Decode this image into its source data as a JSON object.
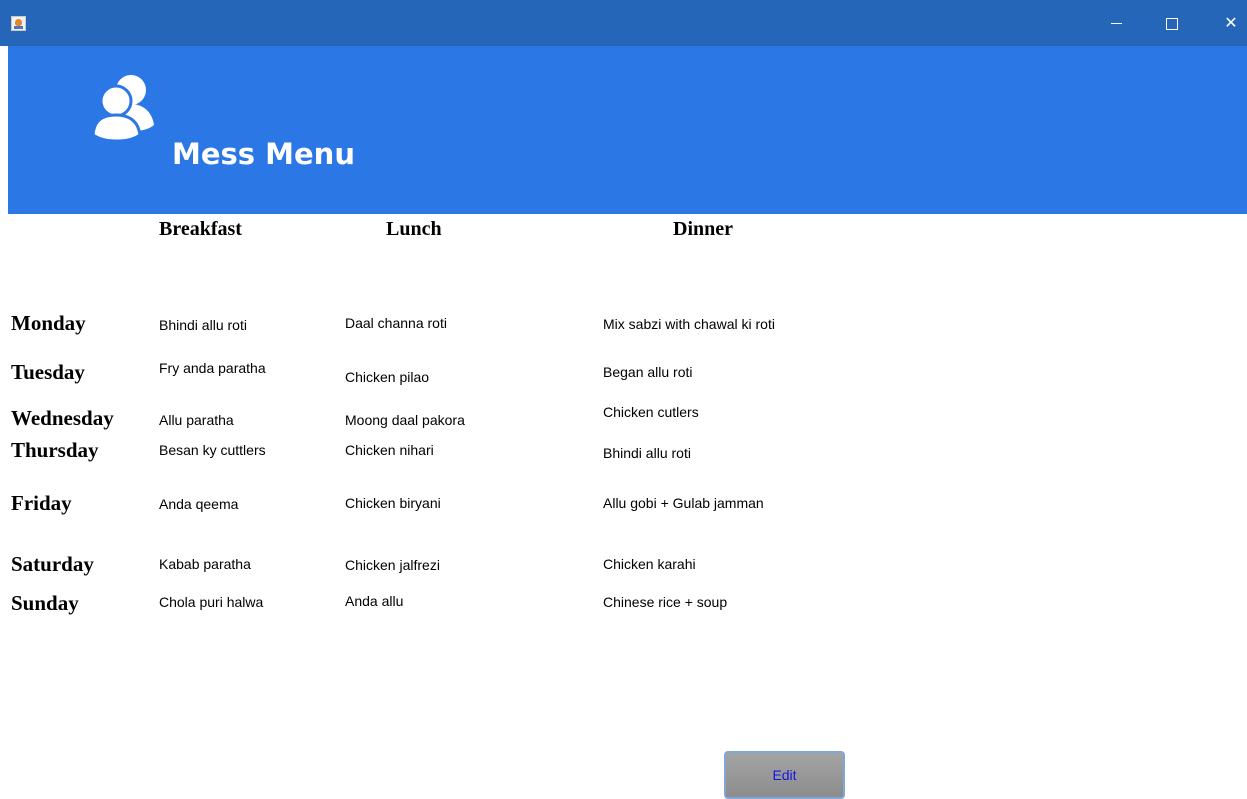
{
  "window": {
    "app_icon": "java-cup-icon",
    "controls": [
      "minimize-icon",
      "maximize-icon",
      "close-icon"
    ]
  },
  "header": {
    "title": "Mess Menu",
    "icon": "users-icon",
    "background": "#2b77e6"
  },
  "columns": {
    "breakfast": "Breakfast",
    "lunch": "Lunch",
    "dinner": "Dinner"
  },
  "rows": [
    {
      "day": "Monday",
      "breakfast": "Bhindi allu roti",
      "lunch": "Daal channa roti",
      "dinner": "Mix sabzi with chawal ki roti"
    },
    {
      "day": "Tuesday",
      "breakfast": "Fry anda paratha",
      "lunch": "Chicken pilao",
      "dinner": "Began allu roti"
    },
    {
      "day": "Wednesday",
      "breakfast": "Allu paratha",
      "lunch": "Moong daal pakora",
      "dinner": "Chicken cutlers"
    },
    {
      "day": "Thursday",
      "breakfast": "Besan ky cuttlers",
      "lunch": "Chicken nihari",
      "dinner": "Bhindi allu roti"
    },
    {
      "day": "Friday",
      "breakfast": "Anda qeema",
      "lunch": "Chicken biryani",
      "dinner": "Allu gobi + Gulab jamman"
    },
    {
      "day": "Saturday",
      "breakfast": "Kabab paratha",
      "lunch": "Chicken jalfrezi",
      "dinner": "Chicken karahi"
    },
    {
      "day": "Sunday",
      "breakfast": "Chola puri halwa",
      "lunch": "Anda allu",
      "dinner": "Chinese rice + soup"
    }
  ],
  "actions": {
    "edit_label": "Edit"
  }
}
